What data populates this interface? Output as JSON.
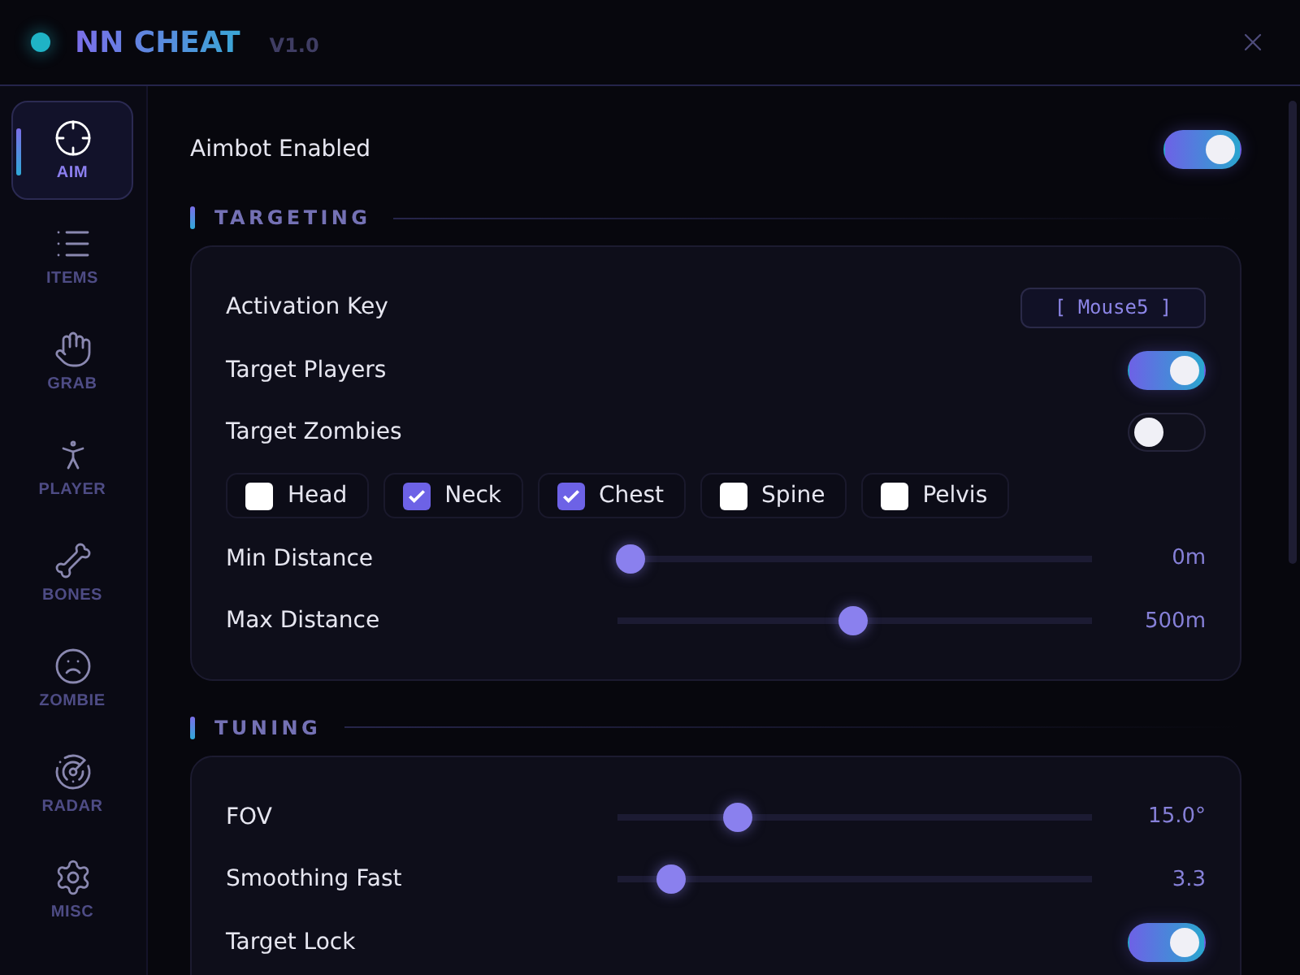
{
  "window": {
    "title": "NN CHEAT",
    "version": "V1.0"
  },
  "sidebar": {
    "items": [
      {
        "label": "AIM",
        "selected": true
      },
      {
        "label": "ITEMS",
        "selected": false
      },
      {
        "label": "GRAB",
        "selected": false
      },
      {
        "label": "PLAYER",
        "selected": false
      },
      {
        "label": "BONES",
        "selected": false
      },
      {
        "label": "ZOMBIE",
        "selected": false
      },
      {
        "label": "RADAR",
        "selected": false
      },
      {
        "label": "MISC",
        "selected": false
      }
    ]
  },
  "master": {
    "label": "Aimbot Enabled",
    "on": true
  },
  "sections": [
    {
      "title": "TARGETING",
      "rows": [
        {
          "kind": "key",
          "label": "Activation Key",
          "value": "[ Mouse5 ]"
        },
        {
          "kind": "toggle",
          "label": "Target Players",
          "on": true
        },
        {
          "kind": "toggle",
          "label": "Target Zombies",
          "on": false
        },
        {
          "kind": "checks",
          "options": [
            {
              "label": "Head",
              "checked": false
            },
            {
              "label": "Neck",
              "checked": true
            },
            {
              "label": "Chest",
              "checked": true
            },
            {
              "label": "Spine",
              "checked": false
            },
            {
              "label": "Pelvis",
              "checked": false
            }
          ]
        },
        {
          "kind": "slider",
          "label": "Min Distance",
          "level": 0,
          "reading": "0m"
        },
        {
          "kind": "slider",
          "label": "Max Distance",
          "level": 0.5,
          "reading": "500m"
        }
      ]
    },
    {
      "title": "TUNING",
      "rows": [
        {
          "kind": "slider",
          "label": "FOV",
          "level": 0.24,
          "reading": "15.0°"
        },
        {
          "kind": "slider",
          "label": "Smoothing Fast",
          "level": 0.09,
          "reading": "3.3"
        },
        {
          "kind": "toggle",
          "label": "Target Lock",
          "on": true
        }
      ]
    }
  ]
}
